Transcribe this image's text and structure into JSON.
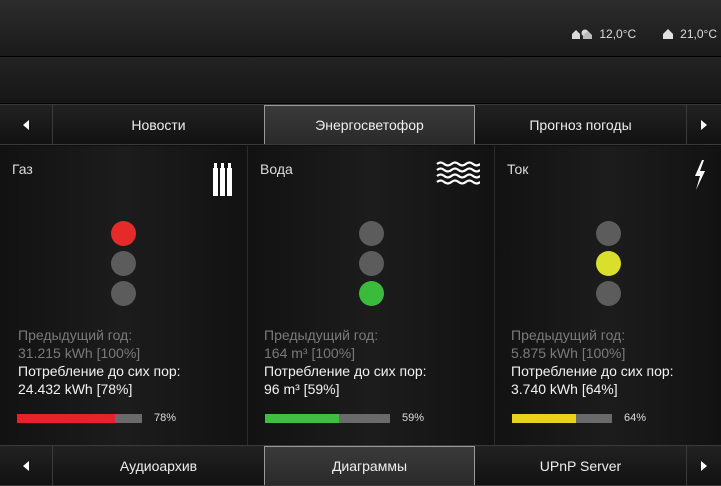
{
  "status": {
    "outdoor_temp": "12,0°C",
    "indoor_temp": "21,0°C"
  },
  "top_tabs": [
    {
      "label": "Новости"
    },
    {
      "label": "Энергосветофор"
    },
    {
      "label": "Прогноз погоды"
    }
  ],
  "bottom_tabs": [
    {
      "label": "Аудиоархив"
    },
    {
      "label": "Диаграммы"
    },
    {
      "label": "UPnP Server"
    }
  ],
  "panels": [
    {
      "title": "Газ",
      "icon": "gas-cylinders-icon",
      "active_light": "red",
      "prev_label": "Предыдущий год:",
      "prev_value": "31.215 kWh [100%]",
      "cur_label": "Потребление до сих пор:",
      "cur_value": "24.432 kWh [78%]",
      "progress": 0.78,
      "progress_color": "#e8222a",
      "percent": "78%"
    },
    {
      "title": "Вода",
      "icon": "water-waves-icon",
      "active_light": "green",
      "prev_label": "Предыдущий год:",
      "prev_value": "164 m³ [100%]",
      "cur_label": "Потребление до сих пор:",
      "cur_value": "96 m³ [59%]",
      "progress": 0.59,
      "progress_color": "#3fbf3f",
      "percent": "59%"
    },
    {
      "title": "Ток",
      "icon": "lightning-icon",
      "active_light": "yellow",
      "prev_label": "Предыдущий год:",
      "prev_value": "5.875 kWh [100%]",
      "cur_label": "Потребление до сих пор:",
      "cur_value": "3.740 kWh [64%]",
      "progress": 0.64,
      "progress_color": "#e8d21e",
      "percent": "64%"
    }
  ],
  "colors": {
    "red": "#e52a2a",
    "yellow": "#d9df2a",
    "green": "#3bbb3b",
    "off": "#5c5c5c"
  }
}
